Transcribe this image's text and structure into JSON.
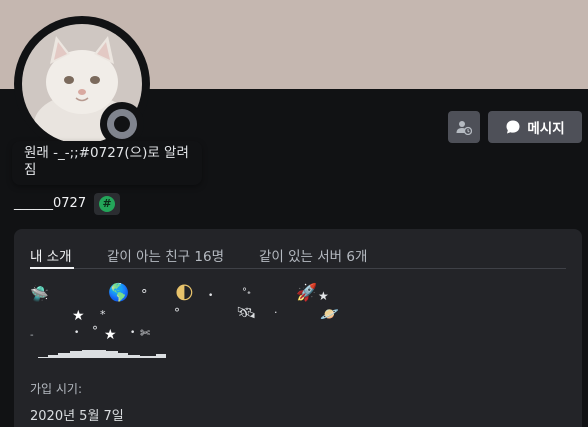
{
  "colors": {
    "banner": "#c5b7b0",
    "background": "#111214",
    "card": "#232428",
    "button": "#4e5058",
    "status_offline": "#80848e",
    "tag_badge": "#23a559"
  },
  "profile": {
    "avatar_icon": "white-cat-avatar",
    "status": "offline",
    "custom_status": "원래 -_-;;#0727(으)로 알려짐",
    "username": "______0727",
    "tag_icon": "hash-badge-icon",
    "tag_symbol": "#"
  },
  "actions": {
    "add_friend_icon": "add-friend-icon",
    "message_icon": "chat-bubble-icon",
    "message_label": "메시지"
  },
  "tabs": [
    {
      "label": "내 소개"
    },
    {
      "label": "같이 아는 친구 16명"
    },
    {
      "label": "같이 있는 서버 6개"
    }
  ],
  "bio_glyphs": {
    "ufo": "🛸",
    "earth": "🌎",
    "moon": "🌓",
    "rocket": "🚀",
    "satellite": "🛰",
    "planet": "🪐",
    "star": "★",
    "small_circle": "°",
    "dot": "•",
    "small_dot": "·",
    "tiny_star": "*",
    "scissors": "✄",
    "dash": "-",
    "ring_dot": "°˖"
  },
  "member_since": {
    "label": "가입 시기:",
    "value": "2020년 5월 7일"
  }
}
